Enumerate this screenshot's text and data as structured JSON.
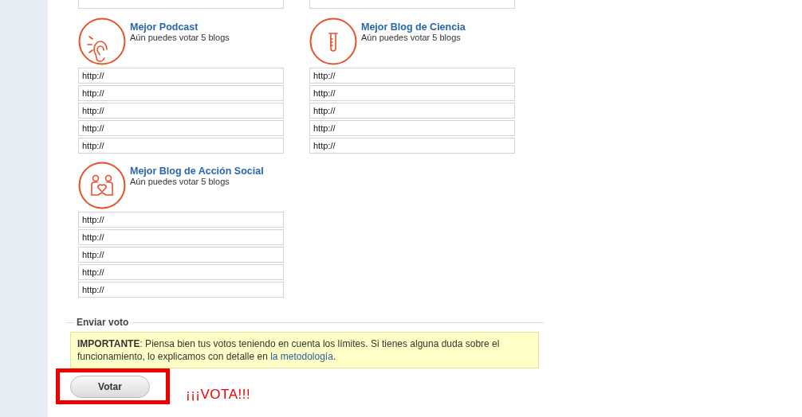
{
  "categories": [
    {
      "kind": "podcast",
      "title": "Mejor Podcast",
      "subtitle": "Aún puedes votar 5 blogs",
      "fields": [
        "http://",
        "http://",
        "http://",
        "http://",
        "http://"
      ]
    },
    {
      "kind": "science",
      "title": "Mejor Blog de Ciencia",
      "subtitle": "Aún puedes votar 5 blogs",
      "fields": [
        "http://",
        "http://",
        "http://",
        "http://",
        "http://"
      ]
    },
    {
      "kind": "social",
      "title": "Mejor Blog de Acción Social",
      "subtitle": "Aún puedes votar 5 blogs",
      "fields": [
        "http://",
        "http://",
        "http://",
        "http://",
        "http://"
      ]
    }
  ],
  "submit_section": {
    "legend": "Enviar voto",
    "notice": "**IMPORTANTE**: Piensa bien tus votos teniendo en cuenta los límites. Si tienes alguna duda sobre el funcionamiento, lo explicamos con detalle en",
    "notice_link": "la metodología",
    "notice_end": ".",
    "button": "Votar",
    "annotation": "¡¡¡VOTA!!!"
  }
}
